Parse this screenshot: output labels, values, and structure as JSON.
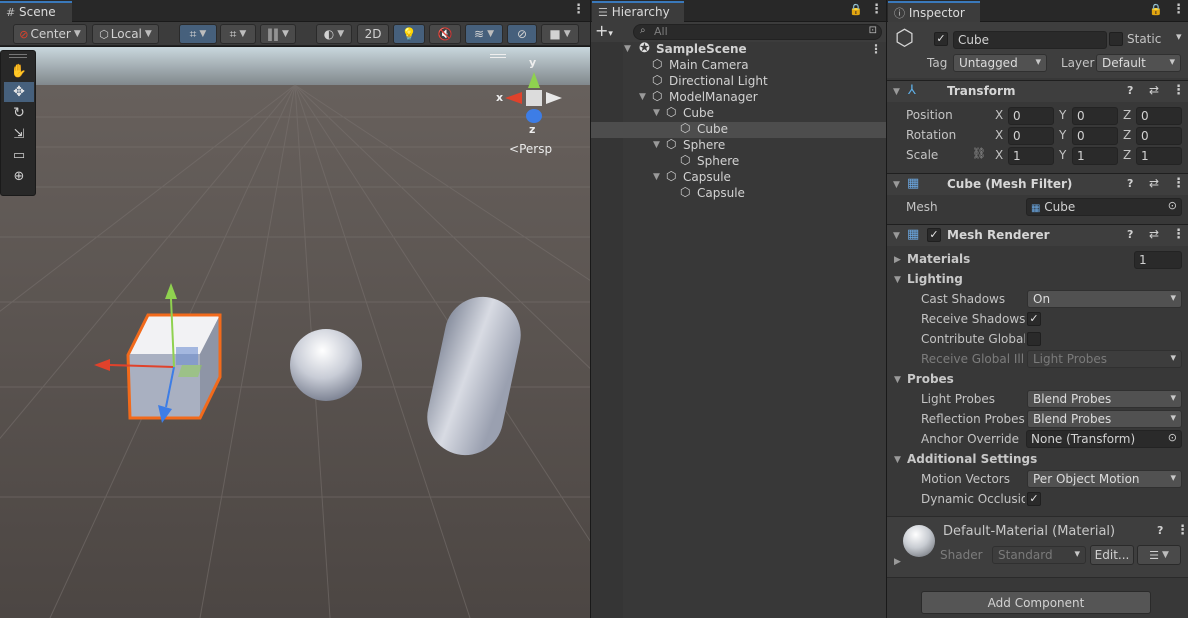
{
  "scene": {
    "tab_label": "Scene",
    "pivot_label": "Center",
    "space_label": "Local",
    "mode_2d": "2D",
    "gizmo_axes": {
      "x": "x",
      "y": "y",
      "z": "z"
    },
    "projection_label": "Persp"
  },
  "hierarchy": {
    "tab_label": "Hierarchy",
    "search_placeholder": "All",
    "items": [
      {
        "label": "SampleScene"
      },
      {
        "label": "Main Camera"
      },
      {
        "label": "Directional Light"
      },
      {
        "label": "ModelManager"
      },
      {
        "label": "Cube"
      },
      {
        "label": "Cube"
      },
      {
        "label": "Sphere"
      },
      {
        "label": "Sphere"
      },
      {
        "label": "Capsule"
      },
      {
        "label": "Capsule"
      }
    ]
  },
  "inspector": {
    "tab_label": "Inspector",
    "object_name": "Cube",
    "static_label": "Static",
    "tag_label": "Tag",
    "tag_value": "Untagged",
    "layer_label": "Layer",
    "layer_value": "Default",
    "transform": {
      "title": "Transform",
      "position_label": "Position",
      "rotation_label": "Rotation",
      "scale_label": "Scale",
      "axis_x": "X",
      "axis_y": "Y",
      "axis_z": "Z",
      "position": [
        "0",
        "0",
        "0"
      ],
      "rotation": [
        "0",
        "0",
        "0"
      ],
      "scale": [
        "1",
        "1",
        "1"
      ]
    },
    "mesh_filter": {
      "title": "Cube (Mesh Filter)",
      "mesh_label": "Mesh",
      "mesh_value": "Cube"
    },
    "mesh_renderer": {
      "title": "Mesh Renderer",
      "materials_label": "Materials",
      "materials_count": "1",
      "lighting_label": "Lighting",
      "cast_shadows_label": "Cast Shadows",
      "cast_shadows_value": "On",
      "receive_shadows_label": "Receive Shadows",
      "contribute_gi_label": "Contribute Global I",
      "receive_gi_label": "Receive Global Illu",
      "receive_gi_value": "Light Probes",
      "probes_label": "Probes",
      "light_probes_label": "Light Probes",
      "light_probes_value": "Blend Probes",
      "reflection_probes_label": "Reflection Probes",
      "reflection_probes_value": "Blend Probes",
      "anchor_override_label": "Anchor Override",
      "anchor_override_value": "None (Transform)",
      "additional_label": "Additional Settings",
      "motion_vectors_label": "Motion Vectors",
      "motion_vectors_value": "Per Object Motion",
      "dynamic_occlusion_label": "Dynamic Occlusion"
    },
    "material": {
      "name": "Default-Material (Material)",
      "shader_label": "Shader",
      "shader_value": "Standard",
      "edit_label": "Edit..."
    },
    "add_component_label": "Add Component"
  },
  "colors": {
    "accent": "#3a79bb",
    "selection": "#46607c",
    "panel": "#383838",
    "scene_ground": "#4f4a47",
    "scene_sky": "#c9d7dd",
    "gizmo_x": "#e0422b",
    "gizmo_y": "#8fd14f",
    "gizmo_z": "#3d7de6",
    "selection_outline": "#f26a1b"
  }
}
